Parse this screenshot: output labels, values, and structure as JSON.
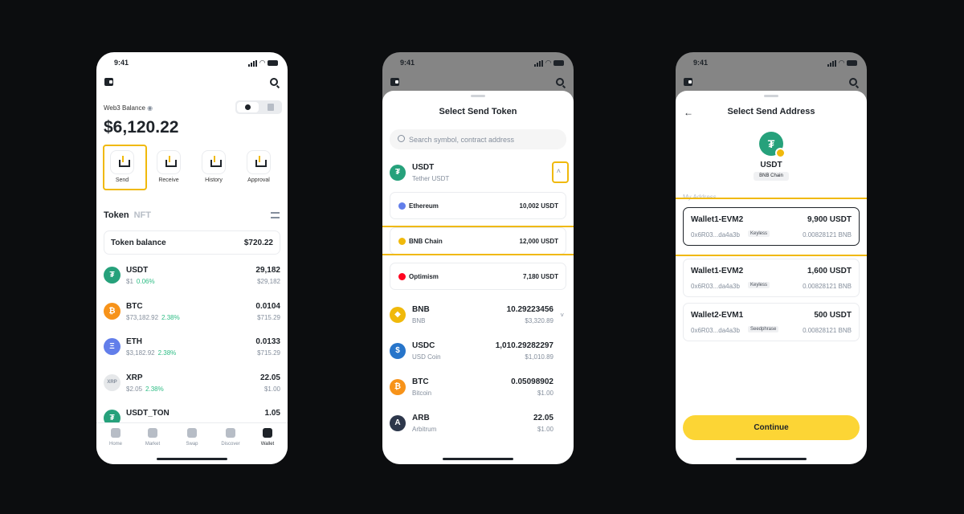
{
  "status_time": "9:41",
  "screen1": {
    "balance_label": "Web3 Balance",
    "balance": "$6,120.22",
    "actions": [
      {
        "label": "Send"
      },
      {
        "label": "Receive"
      },
      {
        "label": "History"
      },
      {
        "label": "Approval"
      }
    ],
    "tabs": {
      "token": "Token",
      "nft": "NFT"
    },
    "token_balance_label": "Token balance",
    "token_balance_value": "$720.22",
    "tokens": [
      {
        "symbol": "USDT",
        "price": "$1",
        "change": "0.06%",
        "amount": "29,182",
        "usd": "$29,182",
        "color": "#26a17b",
        "glyph": "₮"
      },
      {
        "symbol": "BTC",
        "price": "$73,182.92",
        "change": "2.38%",
        "amount": "0.0104",
        "usd": "$715.29",
        "color": "#f7931a",
        "glyph": "₿"
      },
      {
        "symbol": "ETH",
        "price": "$3,182.92",
        "change": "2.38%",
        "amount": "0.0133",
        "usd": "$715.29",
        "color": "#627eea",
        "glyph": "Ξ"
      },
      {
        "symbol": "XRP",
        "price": "$2.05",
        "change": "2.38%",
        "amount": "22.05",
        "usd": "$1.00",
        "color": "#e6e8ea",
        "glyph": "XRP"
      },
      {
        "symbol": "USDT_TON",
        "price": "",
        "change": "",
        "amount": "1.05",
        "usd": "",
        "color": "#26a17b",
        "glyph": "₮"
      }
    ],
    "nav": [
      {
        "label": "Home"
      },
      {
        "label": "Market"
      },
      {
        "label": "Swap"
      },
      {
        "label": "Discover"
      },
      {
        "label": "Wallet"
      }
    ]
  },
  "screen2": {
    "title": "Select Send Token",
    "search_placeholder": "Search symbol, contract address",
    "usdt": {
      "symbol": "USDT",
      "name": "Tether USDT"
    },
    "chains": [
      {
        "name": "Ethereum",
        "value": "10,002 USDT",
        "color": "#627eea"
      },
      {
        "name": "BNB Chain",
        "value": "12,000 USDT",
        "color": "#f0b90b"
      },
      {
        "name": "Optimism",
        "value": "7,180 USDT",
        "color": "#ff0420"
      }
    ],
    "tokens": [
      {
        "symbol": "BNB",
        "name": "BNB",
        "amount": "10.29223456",
        "usd": "$3,320.89",
        "color": "#f0b90b",
        "glyph": "◆"
      },
      {
        "symbol": "USDC",
        "name": "USD Coin",
        "amount": "1,010.29282297",
        "usd": "$1,010.89",
        "color": "#2775ca",
        "glyph": "$"
      },
      {
        "symbol": "BTC",
        "name": "Bitcoin",
        "amount": "0.05098902",
        "usd": "$1.00",
        "color": "#f7931a",
        "glyph": "₿"
      },
      {
        "symbol": "ARB",
        "name": "Arbitrum",
        "amount": "22.05",
        "usd": "$1.00",
        "color": "#2d374b",
        "glyph": "A"
      }
    ]
  },
  "screen3": {
    "title": "Select Send  Address",
    "coin_symbol": "USDT",
    "chain": "BNB Chain",
    "my_address_label": "My Address",
    "addresses": [
      {
        "name": "Wallet1-EVM2",
        "addr": "0x6R03...da4a3b",
        "tag": "Keyless",
        "amount": "9,900 USDT",
        "bnb": "0.00828121 BNB"
      },
      {
        "name": "Wallet1-EVM2",
        "addr": "0x6R03...da4a3b",
        "tag": "Keyless",
        "amount": "1,600 USDT",
        "bnb": "0.00828121 BNB"
      },
      {
        "name": "Wallet2-EVM1",
        "addr": "0x6R03...da4a3b",
        "tag": "Seedphrase",
        "amount": "500 USDT",
        "bnb": "0.00828121 BNB"
      }
    ],
    "continue_label": "Continue"
  }
}
